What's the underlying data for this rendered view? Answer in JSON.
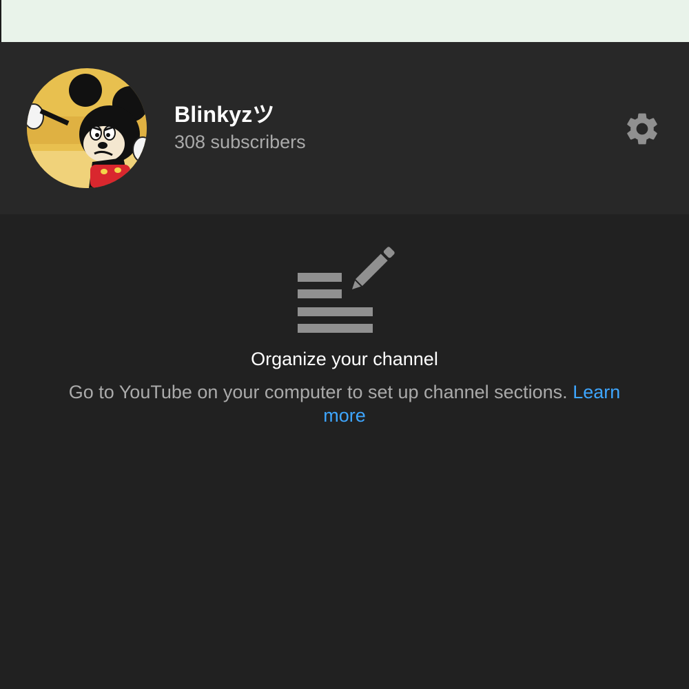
{
  "channel": {
    "name": "Blinkyzツ",
    "subscribers": "308 subscribers",
    "avatar_icon": "cartoon-mouse-avatar",
    "settings_icon": "gear-icon"
  },
  "empty_state": {
    "icon": "edit-sections-icon",
    "title": "Organize your channel",
    "description": "Go to YouTube on your computer to set up channel sections.",
    "link_label": "Learn more"
  },
  "colors": {
    "background": "#212121",
    "header_background": "#282828",
    "top_strip": "#e9f3ea",
    "primary_text": "#ffffff",
    "secondary_text": "#aaaaaa",
    "link": "#3ea6ff",
    "icon": "#909090"
  }
}
